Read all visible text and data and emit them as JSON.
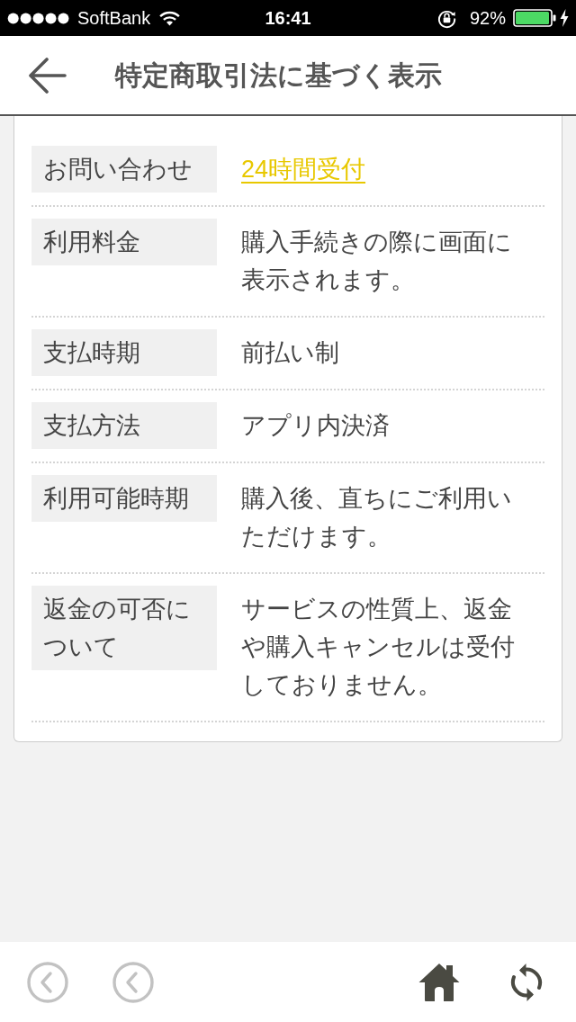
{
  "status_bar": {
    "carrier": "SoftBank",
    "time": "16:41",
    "battery_percent": "92%",
    "charging": true
  },
  "header": {
    "title": "特定商取引法に基づく表示"
  },
  "rows": [
    {
      "label": "お問い合わせ",
      "value": "24時間受付",
      "kind": "link"
    },
    {
      "label": "利用料金",
      "value": "購入手続きの際に画面に表示されます。",
      "kind": "text"
    },
    {
      "label": "支払時期",
      "value": "前払い制",
      "kind": "text"
    },
    {
      "label": "支払方法",
      "value": "アプリ内決済",
      "kind": "text"
    },
    {
      "label": "利用可能時期",
      "value": "購入後、直ちにご利用いただけます。",
      "kind": "text"
    },
    {
      "label": "返金の可否について",
      "value": "サービスの性質上、返金や購入キャンセルは受付しておりません。",
      "kind": "text"
    }
  ],
  "bottom_bar": {
    "buttons": [
      {
        "kind": "chevron",
        "disabled": true
      },
      {
        "kind": "chevron",
        "disabled": true
      },
      {
        "kind": "home",
        "disabled": false
      },
      {
        "kind": "refresh",
        "disabled": false
      }
    ]
  }
}
